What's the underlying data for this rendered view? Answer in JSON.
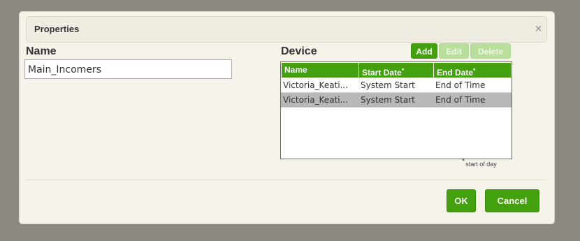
{
  "dialog": {
    "title": "Properties",
    "close_glyph": "×"
  },
  "name_section": {
    "label": "Name",
    "value": "Main_Incomers"
  },
  "device_section": {
    "label": "Device",
    "buttons": {
      "add": "Add",
      "edit": "Edit",
      "delete": "Delete"
    },
    "columns": [
      {
        "label": "Name",
        "star": ""
      },
      {
        "label": "Start Date",
        "star": "*"
      },
      {
        "label": "End Date",
        "star": "*"
      }
    ],
    "rows": [
      {
        "name": "Victoria_Keati...",
        "start": "System Start",
        "end": "End of Time",
        "selected": false
      },
      {
        "name": "Victoria_Keati...",
        "start": "System Start",
        "end": "End of Time",
        "selected": true
      }
    ],
    "footnote_star": "*",
    "footnote": "start of day"
  },
  "footer": {
    "ok": "OK",
    "cancel": "Cancel"
  },
  "colors": {
    "accent": "#44a10e",
    "accent_disabled": "#b8df9c",
    "selected_row": "#b8b8b8",
    "backdrop": "#8c8a80",
    "dialog_bg": "#f6f4ea"
  },
  "icons": {
    "close": "close-icon"
  }
}
